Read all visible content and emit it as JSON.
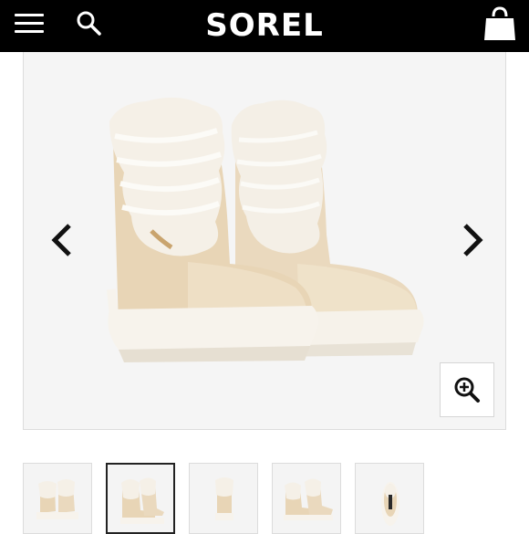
{
  "header": {
    "brand": "SOREL",
    "menu_icon": "hamburger-menu-icon",
    "search_icon": "search-icon",
    "bag_icon": "shopping-bag-icon",
    "background": "#000000"
  },
  "gallery": {
    "product_image": "cream-winter-boots-with-faux-fur-cuff",
    "prev_icon": "chevron-left-icon",
    "next_icon": "chevron-right-icon",
    "zoom_icon": "zoom-in-icon"
  },
  "thumbnails": [
    {
      "view": "pair-front",
      "selected": false
    },
    {
      "view": "pair-front-angle",
      "selected": true
    },
    {
      "view": "single-front",
      "selected": false
    },
    {
      "view": "pair-side",
      "selected": false
    },
    {
      "view": "single-top",
      "selected": false
    }
  ]
}
